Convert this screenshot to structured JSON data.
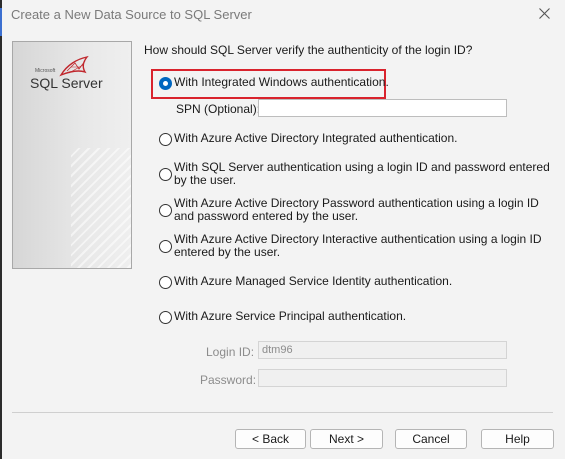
{
  "window": {
    "title": "Create a New Data Source to SQL Server"
  },
  "logo": {
    "brand_small": "Microsoft",
    "product": "SQL Server"
  },
  "question": "How should SQL Server verify the authenticity of the login ID?",
  "options": [
    {
      "label": "With Integrated Windows authentication.",
      "checked": true
    },
    {
      "label": "With Azure Active Directory Integrated authentication.",
      "checked": false
    },
    {
      "label_line1": "With SQL Server authentication using a login ID and password entered",
      "label_line2": "by the user.",
      "checked": false
    },
    {
      "label_line1": "With Azure Active Directory Password authentication using a login ID",
      "label_line2": "and password entered by the user.",
      "checked": false
    },
    {
      "label_line1": "With Azure Active Directory Interactive authentication using a login ID",
      "label_line2": "entered by the user.",
      "checked": false
    },
    {
      "label": "With Azure Managed Service Identity authentication.",
      "checked": false
    },
    {
      "label": "With Azure Service Principal authentication.",
      "checked": false
    }
  ],
  "spn": {
    "label": "SPN (Optional):",
    "value": ""
  },
  "login": {
    "label": "Login ID:",
    "value": "dtm96"
  },
  "password": {
    "label": "Password:",
    "value": ""
  },
  "buttons": {
    "back": "< Back",
    "next": "Next >",
    "cancel": "Cancel",
    "help": "Help"
  },
  "colors": {
    "accent": "#0067c0",
    "highlight": "#d9232d"
  }
}
